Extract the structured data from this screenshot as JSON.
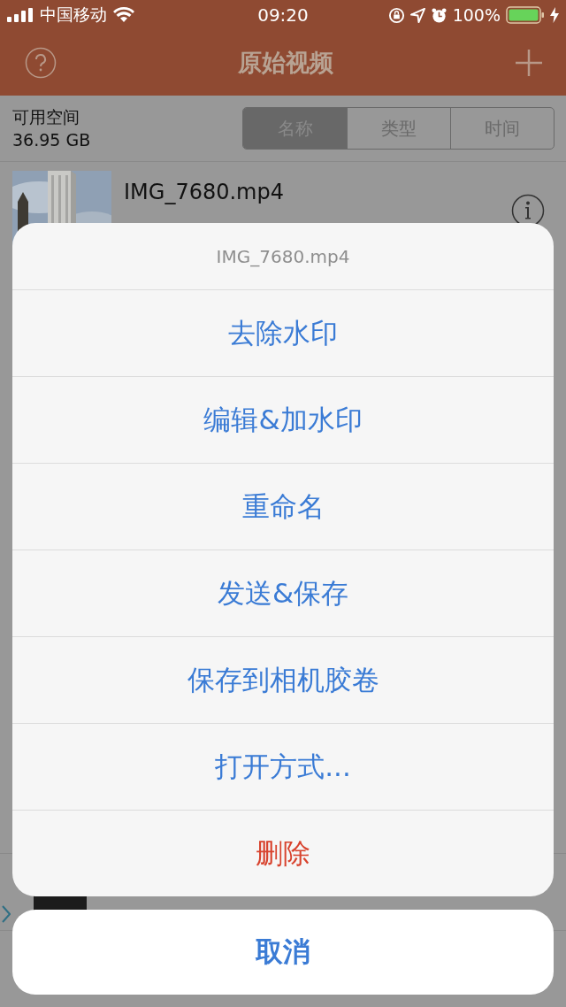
{
  "status_bar": {
    "carrier": "中国移动",
    "time": "09:20",
    "battery": "100%"
  },
  "nav": {
    "title": "原始视频"
  },
  "storage": {
    "label": "可用空间",
    "value": "36.95 GB"
  },
  "sort_tabs": [
    {
      "label": "名称",
      "selected": true
    },
    {
      "label": "类型",
      "selected": false
    },
    {
      "label": "时间",
      "selected": false
    }
  ],
  "files": [
    {
      "name": "IMG_7680.mp4"
    }
  ],
  "action_sheet": {
    "title": "IMG_7680.mp4",
    "actions": [
      {
        "label": "去除水印",
        "kind": "default"
      },
      {
        "label": "编辑&加水印",
        "kind": "default"
      },
      {
        "label": "重命名",
        "kind": "default"
      },
      {
        "label": "发送&保存",
        "kind": "default"
      },
      {
        "label": "保存到相机胶卷",
        "kind": "default"
      },
      {
        "label": "打开方式...",
        "kind": "default"
      },
      {
        "label": "删除",
        "kind": "destructive"
      }
    ],
    "cancel": "取消"
  }
}
